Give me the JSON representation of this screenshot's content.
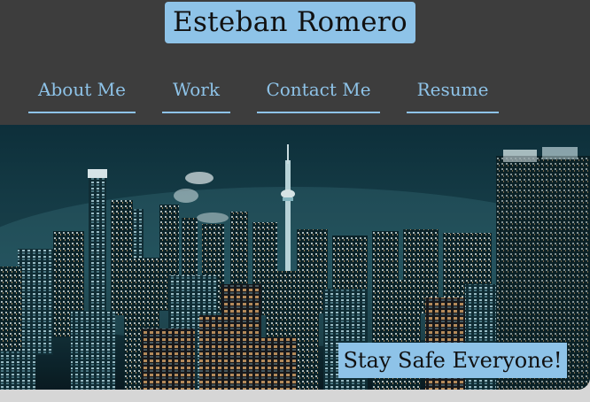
{
  "header": {
    "title": "Esteban Romero"
  },
  "nav": {
    "items": [
      {
        "label": "About Me"
      },
      {
        "label": "Work"
      },
      {
        "label": "Contact Me"
      },
      {
        "label": "Resume"
      }
    ]
  },
  "hero": {
    "image_subject": "night city skyline",
    "tagline": "Stay Safe Everyone!"
  },
  "colors": {
    "header_bg": "#3d3d3d",
    "accent": "#8ec3e8",
    "page_bg": "#d6d6d6"
  }
}
